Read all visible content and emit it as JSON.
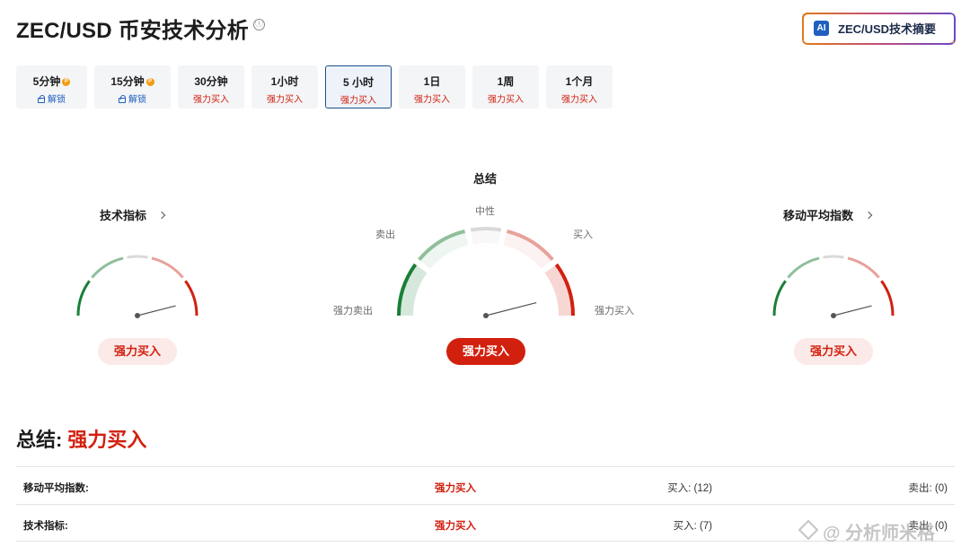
{
  "header": {
    "title": "ZEC/USD 币安技术分析",
    "info_icon": "ⓘ",
    "ai_button": {
      "badge": "AI",
      "label": "ZEC/USD技术摘要"
    }
  },
  "tabs": [
    {
      "label": "5分钟",
      "sub": "解锁",
      "locked": true,
      "pro": true
    },
    {
      "label": "15分钟",
      "sub": "解锁",
      "locked": true,
      "pro": true
    },
    {
      "label": "30分钟",
      "sub": "强力买入"
    },
    {
      "label": "1小时",
      "sub": "强力买入"
    },
    {
      "label": "5 小时",
      "sub": "强力买入",
      "active": true
    },
    {
      "label": "1日",
      "sub": "强力买入"
    },
    {
      "label": "1周",
      "sub": "强力买入"
    },
    {
      "label": "1个月",
      "sub": "强力买入"
    }
  ],
  "gauges": {
    "technical": {
      "title": "技术指标",
      "signal": "强力买入",
      "needle_level": 0.92
    },
    "summary": {
      "title": "总结",
      "signal": "强力买入",
      "needle_level": 0.92,
      "zones": {
        "strong_sell": "强力卖出",
        "sell": "卖出",
        "neutral": "中性",
        "buy": "买入",
        "strong_buy": "强力买入"
      }
    },
    "moving_averages": {
      "title": "移动平均指数",
      "signal": "强力买入",
      "needle_level": 0.92
    }
  },
  "colors": {
    "strong_sell": "#1a7f37",
    "sell": "#8fbf9a",
    "neutral": "#d9d9d9",
    "buy": "#e8a19a",
    "strong_buy": "#d2200f"
  },
  "summary": {
    "label": "总结:",
    "value": "强力买入",
    "rows": [
      {
        "name": "移动平均指数:",
        "signal": "强力买入",
        "buy": "买入: (12)",
        "sell": "卖出: (0)"
      },
      {
        "name": "技术指标:",
        "signal": "强力买入",
        "buy": "买入: (7)",
        "sell": "卖出: (0)"
      }
    ]
  },
  "watermark": "@ 分析师米格"
}
